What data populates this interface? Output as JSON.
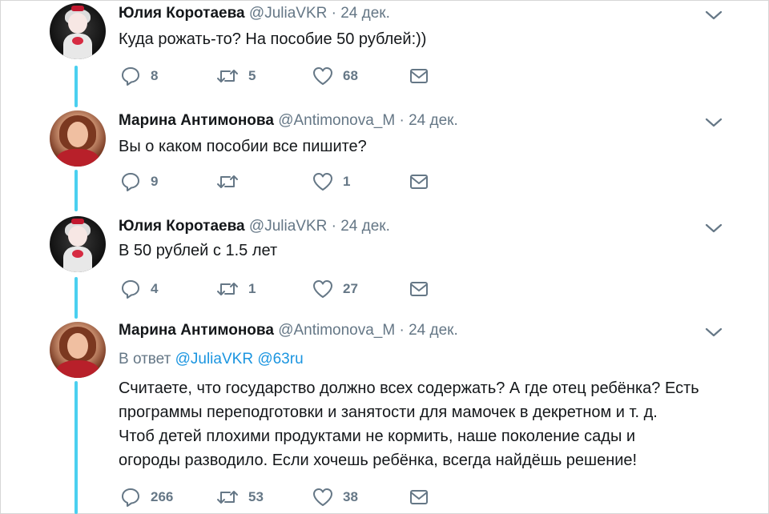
{
  "tweets": [
    {
      "name": "Юлия Коротаева",
      "handle": "@JuliaVKR",
      "date": "24 дек.",
      "text_lines": [
        "Куда рожать-то? На пособие 50 рублей:))"
      ],
      "replies": "8",
      "retweets": "5",
      "likes": "68"
    },
    {
      "name": "Марина Антимонова",
      "handle": "@Antimonova_M",
      "date": "24 дек.",
      "text_lines": [
        "Вы о каком пособии все пишите?"
      ],
      "replies": "9",
      "retweets": "",
      "likes": "1"
    },
    {
      "name": "Юлия Коротаева",
      "handle": "@JuliaVKR",
      "date": "24 дек.",
      "text_lines": [
        "В 50 рублей с 1.5 лет"
      ],
      "replies": "4",
      "retweets": "1",
      "likes": "27"
    },
    {
      "name": "Марина Антимонова",
      "handle": "@Antimonova_M",
      "date": "24 дек.",
      "reply_to_prefix": "В ответ",
      "reply_to_mentions": "@JuliaVKR @63ru",
      "text_lines": [
        "Считаете, что государство должно всех содержать?  А где отец ребёнка? Есть",
        "программы переподготовки и занятости для мамочек в декретном и т. д.",
        "Чтоб детей плохими продуктами не кормить, наше поколение сады и",
        "огороды разводило. Если хочешь ребёнка, всегда найдёшь решение!"
      ],
      "replies": "266",
      "retweets": "53",
      "likes": "38"
    }
  ],
  "separator": "·",
  "icons": {
    "reply": "reply-icon",
    "retweet": "retweet-icon",
    "like": "heart-icon",
    "dm": "envelope-icon",
    "menu": "chevron-down-icon"
  },
  "colors": {
    "thread_line": "#4ad0f0",
    "link": "#1b95e0",
    "muted": "#657786",
    "text": "#14171a"
  }
}
